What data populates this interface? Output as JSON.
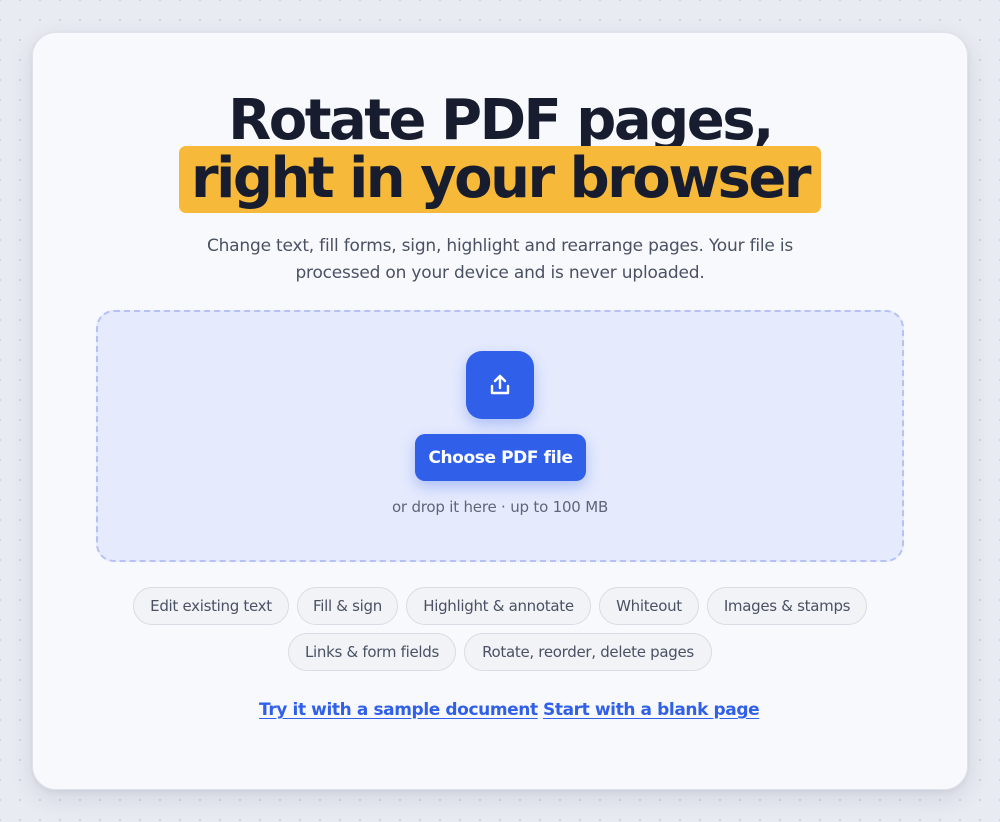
{
  "hero": {
    "title_line1": "Rotate PDF pages,",
    "title_line2": "right in your browser",
    "highlight_color": "#f6b93a"
  },
  "subtitle": "Change text, fill forms, sign, highlight and rearrange pages. Your file is processed on your device and is never uploaded.",
  "dropzone": {
    "icon": "upload-icon",
    "choose_button": "Choose PDF file",
    "hint": "or drop it here · up to 100 MB",
    "accent_color": "#3060ea"
  },
  "features": [
    "Edit existing text",
    "Fill & sign",
    "Highlight & annotate",
    "Whiteout",
    "Images & stamps",
    "Links & form fields",
    "Rotate, reorder, delete pages"
  ],
  "links": {
    "sample": "Try it with a sample document",
    "blank": "Start with a blank page"
  }
}
